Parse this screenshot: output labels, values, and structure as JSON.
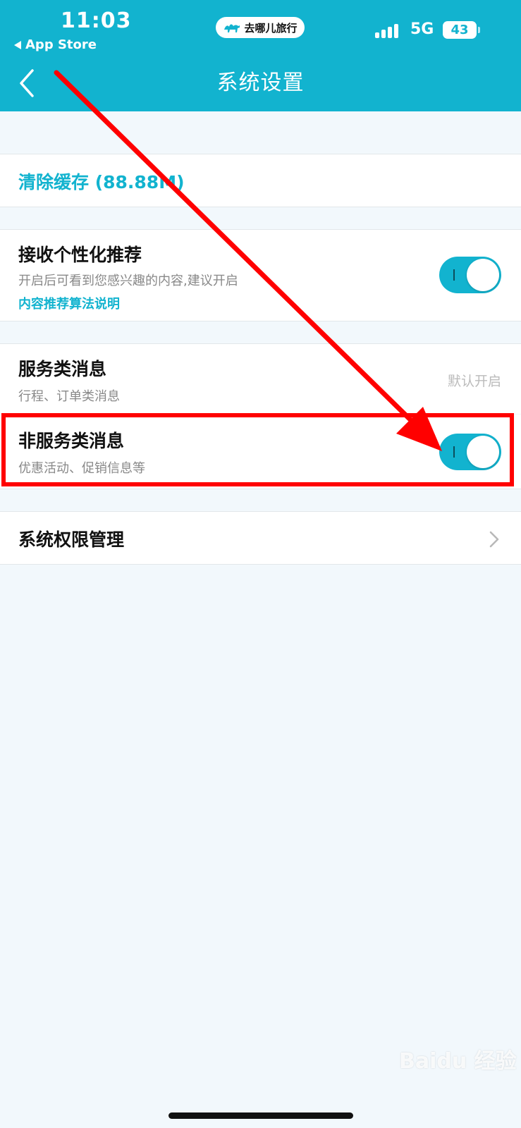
{
  "status_bar": {
    "time": "11:03",
    "back_app": "App Store",
    "app_name": "去哪儿旅行",
    "network": "5G",
    "battery": "43"
  },
  "header": {
    "title": "系统设置",
    "back_icon": "chevron-left-icon"
  },
  "settings": {
    "clear_cache": "清除缓存 (88.88M)",
    "personalized": {
      "title": "接收个性化推荐",
      "subtitle": "开启后可看到您感兴趣的内容,建议开启",
      "link": "内容推荐算法说明",
      "enabled": true
    },
    "service_msg": {
      "title": "服务类消息",
      "subtitle": "行程、订单类消息",
      "status": "默认开启"
    },
    "non_service_msg": {
      "title": "非服务类消息",
      "subtitle": "优惠活动、促销信息等",
      "enabled": true
    },
    "permissions": {
      "title": "系统权限管理",
      "icon": "chevron-right-icon"
    }
  },
  "watermark": "Baidu 经验",
  "colors": {
    "accent": "#12b3cf",
    "annotation": "#ff0000",
    "background": "#f2f8fc"
  }
}
